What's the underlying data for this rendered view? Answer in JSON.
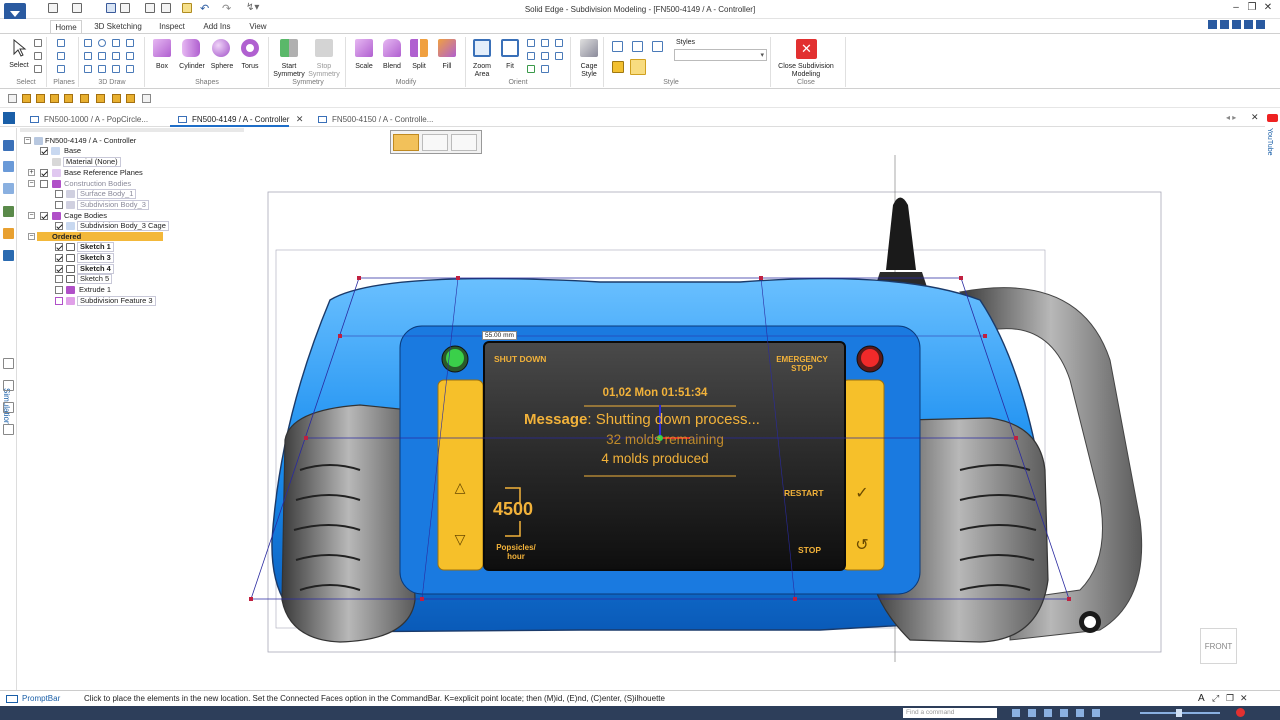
{
  "window": {
    "title": "Solid Edge - Subdivision Modeling - [FN500-4149 / A - Controller]"
  },
  "ribbon_tabs": [
    {
      "label": "Home",
      "active": true
    },
    {
      "label": "3D Sketching"
    },
    {
      "label": "Inspect"
    },
    {
      "label": "Add Ins"
    },
    {
      "label": "View"
    }
  ],
  "ribbon": {
    "select": {
      "label": "Select",
      "group": "Select"
    },
    "planes": {
      "group": "Planes"
    },
    "draw3d": {
      "group": "3D Draw"
    },
    "shapes": {
      "box": "Box",
      "cylinder": "Cylinder",
      "sphere": "Sphere",
      "torus": "Torus",
      "group": "Shapes"
    },
    "symmetry": {
      "start": "Start",
      "start2": "Symmetry",
      "stop": "Stop",
      "stop2": "Symmetry",
      "group": "Symmetry"
    },
    "modify": {
      "scale": "Scale",
      "blend": "Blend",
      "split": "Split",
      "fill": "Fill",
      "group": "Modify"
    },
    "orient": {
      "zoom_area": "Zoom",
      "zoom_area2": "Area",
      "fit": "Fit",
      "group": "Orient"
    },
    "cage_style": {
      "label": "Cage",
      "label2": "Style"
    },
    "style": {
      "styles_label": "Styles",
      "group": "Style"
    },
    "close": {
      "label": "Close Subdivision",
      "label2": "Modeling",
      "group": "Close"
    }
  },
  "doc_tabs": [
    {
      "label": "FN500-1000 / A - PopCircle...",
      "active": false
    },
    {
      "label": "FN500-4149 / A - Controller",
      "active": true
    },
    {
      "label": "FN500-4150 / A - Controlle...",
      "active": false
    }
  ],
  "rail": {
    "simulation": "Simulation"
  },
  "tree": {
    "root": "FN500-4149 / A - Controller",
    "items": [
      {
        "label": "Base"
      },
      {
        "label": "Material (None)"
      },
      {
        "label": "Base Reference Planes"
      },
      {
        "label": "Construction Bodies"
      },
      {
        "label": "Surface Body_1"
      },
      {
        "label": "Subdivision Body_3"
      },
      {
        "label": "Cage Bodies"
      },
      {
        "label": "Subdivision Body_3 Cage"
      },
      {
        "label": "Ordered"
      },
      {
        "label": "Sketch 1"
      },
      {
        "label": "Sketch 3"
      },
      {
        "label": "Sketch 4"
      },
      {
        "label": "Sketch 5"
      },
      {
        "label": "Extrude 1"
      },
      {
        "label": "Subdivision Feature 3"
      }
    ]
  },
  "canvas": {
    "dimension_label": "55.00 mm",
    "view_label": "FRONT",
    "device_screen": {
      "shut_down": "SHUT DOWN",
      "emergency_stop": "EMERGENCY",
      "emergency_stop2": "STOP",
      "datetime": "01,02 Mon 01:51:34",
      "message_prefix": "Message",
      "message_text": ": Shutting down process...",
      "molds_remaining": "32 molds remaining",
      "molds_produced": "4 molds produced",
      "restart": "RESTART",
      "stop": "STOP",
      "rate_value": "4500",
      "rate_label": "Popsicles/",
      "rate_label2": "hour"
    }
  },
  "right_rail": {
    "label": "YouTube"
  },
  "statusbar": {
    "promptbar_label": "PromptBar",
    "prompt": "Click to place the elements in the new location.  Set the Connected Faces option in the CommandBar.  K=explicit point locate; then (M)id, (E)nd, (C)enter, (S)ilhouette",
    "find_command_placeholder": "Find a command"
  },
  "colors": {
    "accent": "#1e6ec8",
    "device_blue": "#1a8ef0",
    "screen_text": "#f2b23a",
    "highlight": "#f3b83a",
    "close_red": "#e23030"
  }
}
